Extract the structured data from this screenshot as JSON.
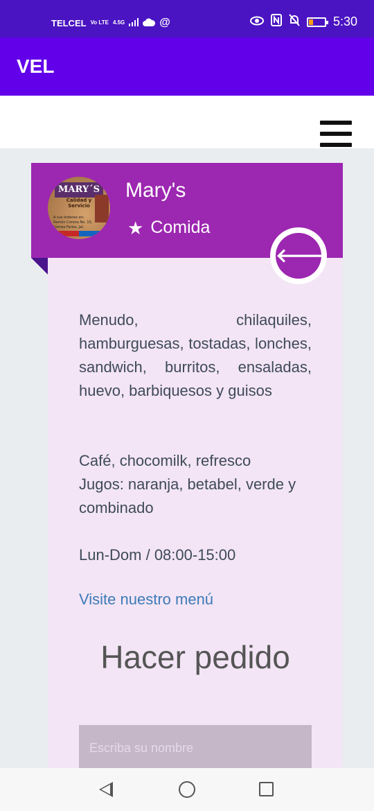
{
  "status_bar": {
    "carrier": "TELCEL",
    "volte": "Vo LTE",
    "network": "4.5G",
    "time": "5:30"
  },
  "app_bar": {
    "title": "VEL"
  },
  "restaurant": {
    "name": "Mary's",
    "category": "Comida",
    "logo": {
      "title": "MARY´S",
      "subtitle": "Calidad y Servicio",
      "lines": [
        "A sus órdenes en:",
        "Ramón Corona No. 15,",
        "Gómez Farías, Jal."
      ]
    }
  },
  "description": {
    "dishes": "Menudo, chilaquiles, hamburguesas, tostadas, lonches, sandwich, burritos, ensaladas, huevo, barbiquesos y guisos",
    "drinks_line1": "Café, chocomilk, refresco",
    "drinks_line2": "Jugos: naranja, betabel, verde y combinado",
    "hours": "Lun-Dom / 08:00-15:00",
    "menu_link": "Visite nuestro menú"
  },
  "order_form": {
    "title": "Hacer pedido",
    "name_placeholder": "Escriba su nombre"
  },
  "colors": {
    "status_bar": "#4a14c2",
    "app_bar": "#6200ea",
    "card_header": "#9c27b0",
    "card_body": "#f3e5f5",
    "link": "#3d7ab8"
  },
  "icons": [
    "eye-icon",
    "nfc-icon",
    "bell-off-icon",
    "battery-icon",
    "cloud-icon",
    "at-icon",
    "signal-icon",
    "hamburger-menu-icon",
    "star-icon",
    "arrow-left-icon"
  ]
}
